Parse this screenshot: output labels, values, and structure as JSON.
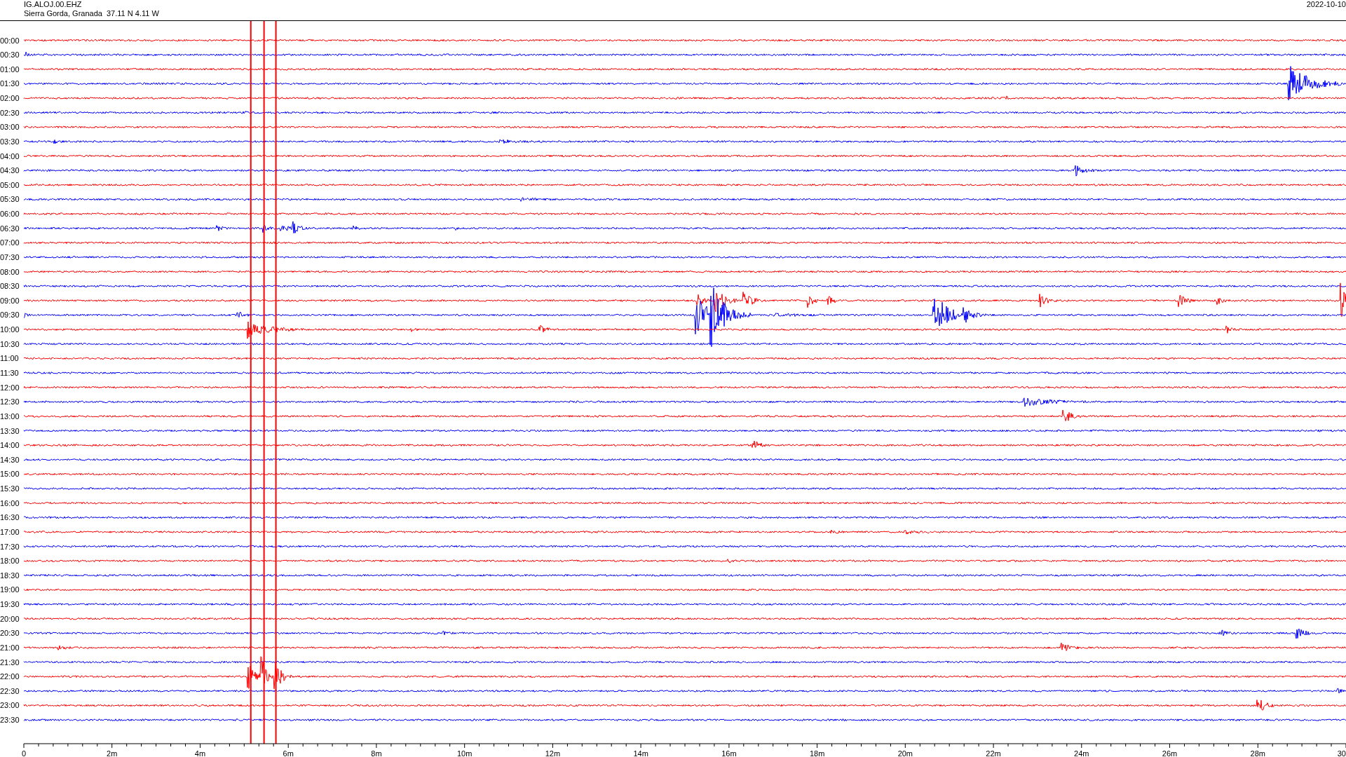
{
  "header": {
    "station": "IG.ALOJ.00.EHZ",
    "location": "Sierra Gorda, Granada  37.11 N 4.11 W",
    "date": "2022-10-10"
  },
  "rows": [
    {
      "label": "00:00",
      "color": "#ff0000"
    },
    {
      "label": "00:30",
      "color": "#0000ff"
    },
    {
      "label": "01:00",
      "color": "#ff0000"
    },
    {
      "label": "01:30",
      "color": "#0000ff"
    },
    {
      "label": "02:00",
      "color": "#ff0000"
    },
    {
      "label": "02:30",
      "color": "#0000ff"
    },
    {
      "label": "03:00",
      "color": "#ff0000"
    },
    {
      "label": "03:30",
      "color": "#0000ff"
    },
    {
      "label": "04:00",
      "color": "#ff0000"
    },
    {
      "label": "04:30",
      "color": "#0000ff"
    },
    {
      "label": "05:00",
      "color": "#ff0000"
    },
    {
      "label": "05:30",
      "color": "#0000ff"
    },
    {
      "label": "06:00",
      "color": "#ff0000"
    },
    {
      "label": "06:30",
      "color": "#0000ff"
    },
    {
      "label": "07:00",
      "color": "#ff0000"
    },
    {
      "label": "07:30",
      "color": "#0000ff"
    },
    {
      "label": "08:00",
      "color": "#ff0000"
    },
    {
      "label": "08:30",
      "color": "#0000ff"
    },
    {
      "label": "09:00",
      "color": "#ff0000"
    },
    {
      "label": "09:30",
      "color": "#0000ff"
    },
    {
      "label": "10:00",
      "color": "#ff0000"
    },
    {
      "label": "10:30",
      "color": "#0000ff"
    },
    {
      "label": "11:00",
      "color": "#ff0000"
    },
    {
      "label": "11:30",
      "color": "#0000ff"
    },
    {
      "label": "12:00",
      "color": "#ff0000"
    },
    {
      "label": "12:30",
      "color": "#0000ff"
    },
    {
      "label": "13:00",
      "color": "#ff0000"
    },
    {
      "label": "13:30",
      "color": "#0000ff"
    },
    {
      "label": "14:00",
      "color": "#ff0000"
    },
    {
      "label": "14:30",
      "color": "#0000ff"
    },
    {
      "label": "15:00",
      "color": "#ff0000"
    },
    {
      "label": "15:30",
      "color": "#0000ff"
    },
    {
      "label": "16:00",
      "color": "#ff0000"
    },
    {
      "label": "16:30",
      "color": "#0000ff"
    },
    {
      "label": "17:00",
      "color": "#ff0000"
    },
    {
      "label": "17:30",
      "color": "#0000ff"
    },
    {
      "label": "18:00",
      "color": "#ff0000"
    },
    {
      "label": "18:30",
      "color": "#0000ff"
    },
    {
      "label": "19:00",
      "color": "#ff0000"
    },
    {
      "label": "19:30",
      "color": "#0000ff"
    },
    {
      "label": "20:00",
      "color": "#ff0000"
    },
    {
      "label": "20:30",
      "color": "#0000ff"
    },
    {
      "label": "21:00",
      "color": "#ff0000"
    },
    {
      "label": "21:30",
      "color": "#0000ff"
    },
    {
      "label": "22:00",
      "color": "#ff0000"
    },
    {
      "label": "22:30",
      "color": "#0000ff"
    },
    {
      "label": "23:00",
      "color": "#ff0000"
    },
    {
      "label": "23:30",
      "color": "#0000ff"
    }
  ],
  "x_axis": {
    "labels": [
      "0",
      "2m",
      "4m",
      "6m",
      "8m",
      "10m",
      "12m",
      "14m",
      "16m",
      "18m",
      "20m",
      "22m",
      "24m",
      "26m",
      "28m",
      "30"
    ]
  }
}
